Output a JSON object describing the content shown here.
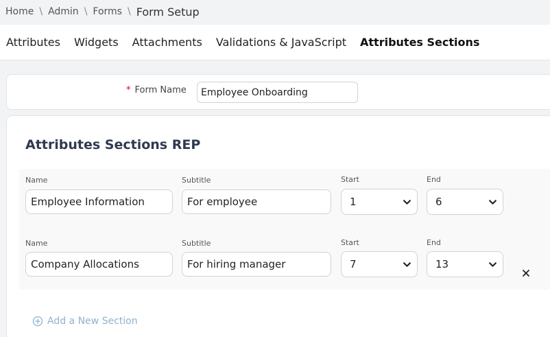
{
  "breadcrumb": {
    "items": [
      "Home",
      "Admin",
      "Forms"
    ],
    "separator": "\\",
    "current": "Form Setup"
  },
  "tabs": [
    {
      "label": "Attributes",
      "active": false
    },
    {
      "label": "Widgets",
      "active": false
    },
    {
      "label": "Attachments",
      "active": false
    },
    {
      "label": "Validations & JavaScript",
      "active": false
    },
    {
      "label": "Attributes Sections",
      "active": true
    }
  ],
  "form": {
    "required_marker": "*",
    "name_label": "Form Name",
    "name_value": "Employee Onboarding"
  },
  "sections": {
    "title": "Attributes Sections REP",
    "labels": {
      "name": "Name",
      "subtitle": "Subtitle",
      "start": "Start",
      "end": "End"
    },
    "rows": [
      {
        "name": "Employee Information",
        "subtitle": "For employee",
        "start": "1",
        "end": "6"
      },
      {
        "name": "Company Allocations",
        "subtitle": "For hiring manager",
        "start": "7",
        "end": "13"
      }
    ],
    "add_label": "Add a New Section",
    "remove_icon": "close-icon"
  },
  "colors": {
    "accent_link": "#8fb2c9",
    "required": "#d0021b",
    "title": "#2f3a4f"
  }
}
